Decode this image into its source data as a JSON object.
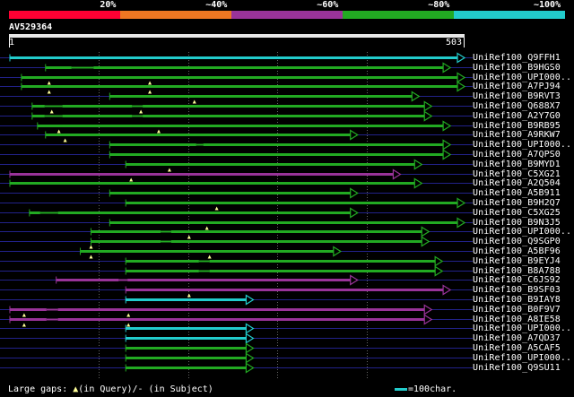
{
  "legend": {
    "labels": [
      "20%",
      "~40%",
      "~60%",
      "~80%",
      "~100%"
    ],
    "colors": [
      "#ff0033",
      "#ee7722",
      "#993399",
      "#22aa22",
      "#22cccc"
    ]
  },
  "query": {
    "name": "AV529364",
    "start": "1",
    "end": "503"
  },
  "hits": [
    {
      "label": "UniRef100_Q9FFH1",
      "color": "cyan",
      "query_start": 1,
      "query_end": 503,
      "query_gap": null,
      "subject_gaps": []
    },
    {
      "label": "UniRef100_B9HGS0",
      "color": "green",
      "query_start": 41,
      "query_end": 487,
      "query_gap": null,
      "subject_gaps": [
        [
          70,
          95
        ]
      ]
    },
    {
      "label": "UniRef100_UPI000..",
      "color": "green",
      "query_start": 14,
      "query_end": 503,
      "query_gap": [
        45,
        158
      ],
      "subject_gaps": []
    },
    {
      "label": "UniRef100_A7PJ94",
      "color": "green",
      "query_start": 14,
      "query_end": 503,
      "query_gap": [
        45,
        158
      ],
      "subject_gaps": []
    },
    {
      "label": "UniRef100_B9RVT3",
      "color": "green",
      "query_start": 113,
      "query_end": 452,
      "query_gap": [
        208
      ],
      "subject_gaps": []
    },
    {
      "label": "UniRef100_Q688X7",
      "color": "green",
      "query_start": 26,
      "query_end": 466,
      "query_gap": [
        48,
        148
      ],
      "subject_gaps": [
        [
          40,
          60
        ],
        [
          138,
          150
        ]
      ]
    },
    {
      "label": "UniRef100_A2Y7G0",
      "color": "green",
      "query_start": 26,
      "query_end": 466,
      "query_gap": null,
      "subject_gaps": [
        [
          40,
          60
        ],
        [
          138,
          150
        ]
      ]
    },
    {
      "label": "UniRef100_B9RB95",
      "color": "green",
      "query_start": 32,
      "query_end": 487,
      "query_gap": [
        56,
        168
      ],
      "subject_gaps": []
    },
    {
      "label": "UniRef100_A9RKW7",
      "color": "green",
      "query_start": 41,
      "query_end": 383,
      "query_gap": [
        63
      ],
      "subject_gaps": []
    },
    {
      "label": "UniRef100_UPI000..",
      "color": "green",
      "query_start": 113,
      "query_end": 487,
      "query_gap": null,
      "subject_gaps": [
        [
          210,
          218
        ]
      ]
    },
    {
      "label": "UniRef100_A7QPS0",
      "color": "green",
      "query_start": 113,
      "query_end": 487,
      "query_gap": null,
      "subject_gaps": []
    },
    {
      "label": "UniRef100_B9MYD1",
      "color": "green",
      "query_start": 131,
      "query_end": 455,
      "query_gap": [
        180
      ],
      "subject_gaps": []
    },
    {
      "label": "UniRef100_C5XG21",
      "color": "purple",
      "query_start": 1,
      "query_end": 431,
      "query_gap": [
        137
      ],
      "subject_gaps": []
    },
    {
      "label": "UniRef100_A2Q504",
      "color": "green",
      "query_start": 1,
      "query_end": 455,
      "query_gap": null,
      "subject_gaps": []
    },
    {
      "label": "UniRef100_A5B911",
      "color": "green",
      "query_start": 113,
      "query_end": 383,
      "query_gap": null,
      "subject_gaps": []
    },
    {
      "label": "UniRef100_B9H2Q7",
      "color": "green",
      "query_start": 131,
      "query_end": 503,
      "query_gap": [
        233
      ],
      "subject_gaps": []
    },
    {
      "label": "UniRef100_C5XG25",
      "color": "green",
      "query_start": 23,
      "query_end": 383,
      "query_gap": null,
      "subject_gaps": [
        [
          35,
          55
        ]
      ]
    },
    {
      "label": "UniRef100_B9N3J5",
      "color": "green",
      "query_start": 113,
      "query_end": 503,
      "query_gap": [
        222
      ],
      "subject_gaps": []
    },
    {
      "label": "UniRef100_UPI000..",
      "color": "green",
      "query_start": 92,
      "query_end": 463,
      "query_gap": [
        202
      ],
      "subject_gaps": [
        [
          170,
          182
        ]
      ]
    },
    {
      "label": "UniRef100_Q9SGP0",
      "color": "green",
      "query_start": 92,
      "query_end": 463,
      "query_gap": [
        92
      ],
      "subject_gaps": [
        [
          170,
          182
        ]
      ]
    },
    {
      "label": "UniRef100_A5BF96",
      "color": "green",
      "query_start": 80,
      "query_end": 364,
      "query_gap": [
        92,
        225
      ],
      "subject_gaps": []
    },
    {
      "label": "UniRef100_B9EYJ4",
      "color": "green",
      "query_start": 131,
      "query_end": 478,
      "query_gap": null,
      "subject_gaps": [
        [
          213,
          225
        ]
      ]
    },
    {
      "label": "UniRef100_B8A788",
      "color": "green",
      "query_start": 131,
      "query_end": 478,
      "query_gap": null,
      "subject_gaps": [
        [
          213,
          225
        ]
      ]
    },
    {
      "label": "UniRef100_C6JS92",
      "color": "purple",
      "query_start": 53,
      "query_end": 383,
      "query_gap": null,
      "subject_gaps": [
        [
          123,
          133
        ]
      ]
    },
    {
      "label": "UniRef100_B9SF03",
      "color": "purple",
      "query_start": 131,
      "query_end": 487,
      "query_gap": [
        202
      ],
      "subject_gaps": []
    },
    {
      "label": "UniRef100_B9IAY8",
      "color": "cyan",
      "query_start": 131,
      "query_end": 266,
      "query_gap": null,
      "subject_gaps": []
    },
    {
      "label": "UniRef100_B0F9V7",
      "color": "purple",
      "query_start": 1,
      "query_end": 466,
      "query_gap": [
        17,
        134
      ],
      "subject_gaps": [
        [
          42,
          55
        ]
      ]
    },
    {
      "label": "UniRef100_A8IE58",
      "color": "purple",
      "query_start": 1,
      "query_end": 466,
      "query_gap": [
        17,
        134
      ],
      "subject_gaps": [
        [
          42,
          55
        ]
      ]
    },
    {
      "label": "UniRef100_UPI000..",
      "color": "cyan",
      "query_start": 131,
      "query_end": 266,
      "query_gap": null,
      "subject_gaps": []
    },
    {
      "label": "UniRef100_A7QD37",
      "color": "cyan",
      "query_start": 131,
      "query_end": 266,
      "query_gap": null,
      "subject_gaps": []
    },
    {
      "label": "UniRef100_A5CAF5",
      "color": "green",
      "query_start": 131,
      "query_end": 266,
      "query_gap": null,
      "subject_gaps": []
    },
    {
      "label": "UniRef100_UPI000..",
      "color": "green",
      "query_start": 131,
      "query_end": 266,
      "query_gap": null,
      "subject_gaps": []
    },
    {
      "label": "UniRef100_Q9SU11",
      "color": "green",
      "query_start": 131,
      "query_end": 266,
      "query_gap": null,
      "subject_gaps": []
    }
  ],
  "colors": {
    "green": "#22aa22",
    "cyan": "#22cccc",
    "purple": "#993399",
    "axis_line": "#22228a",
    "grid": "#666666",
    "query_gap_marker": "#ffff99"
  },
  "footer": {
    "prefix": "Large gaps: ",
    "tri_glyph": "▲",
    "rest": "(in Query)/- (in Subject)",
    "scale_label": "=100char."
  }
}
